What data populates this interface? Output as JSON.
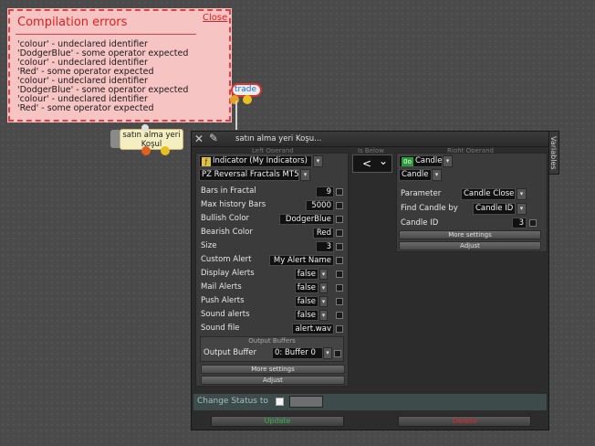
{
  "errors": {
    "title": "Compilation errors",
    "close_label": "Close",
    "messages": [
      "'colour' - undeclared identifier",
      "'DodgerBlue' - some operator expected",
      "'colour' - undeclared identifier",
      "'Red' - some operator expected",
      "'colour' - undeclared identifier",
      "'DodgerBlue' - some operator expected",
      "'colour' - undeclared identifier",
      "'Red' - some operator expected"
    ]
  },
  "nodes": {
    "trade_label": "trade",
    "buy_label": "satın alma yeri Koşul"
  },
  "panel": {
    "title": "satın alma yeri Koşu...",
    "variables_tab": "Variables",
    "left_heading": "Left Operand",
    "middle_heading": "Is Below",
    "right_heading": "Right Operand",
    "left": {
      "type_select": "Indicator (My Indicators)",
      "indicator_select": "PZ Reversal Fractals MT5",
      "params": [
        {
          "label": "Bars in Fractal",
          "value": "9"
        },
        {
          "label": "Max history Bars",
          "value": "5000"
        },
        {
          "label": "Bullish Color",
          "value": "DodgerBlue"
        },
        {
          "label": "Bearish Color",
          "value": "Red"
        },
        {
          "label": "Size",
          "value": "3"
        },
        {
          "label": "Custom Alert",
          "value": "My Alert Name"
        },
        {
          "label": "Display Alerts",
          "value": "false"
        },
        {
          "label": "Mail Alerts",
          "value": "false"
        },
        {
          "label": "Push Alerts",
          "value": "false"
        },
        {
          "label": "Sound alerts",
          "value": "false"
        },
        {
          "label": "Sound file",
          "value": "alert.wav"
        }
      ],
      "output_heading": "Output Buffers",
      "output_label": "Output Buffer",
      "output_value": "0: Buffer 0",
      "more_settings": "More settings",
      "adjust": "Adjust"
    },
    "operator": {
      "symbol": "<",
      "caret": "⌄"
    },
    "right": {
      "type_select": "Candle",
      "candle_select": "Candle",
      "params": [
        {
          "label": "Parameter",
          "value": "Candle Close"
        },
        {
          "label": "Find Candle by",
          "value": "Candle ID"
        },
        {
          "label": "Candle ID",
          "value": "3"
        }
      ],
      "more_settings": "More settings",
      "adjust": "Adjust"
    },
    "status_label": "Change Status to",
    "update_label": "Update",
    "delete_label": "Delete"
  },
  "colors": {
    "update": "#2fb34a",
    "delete": "#e02828"
  }
}
